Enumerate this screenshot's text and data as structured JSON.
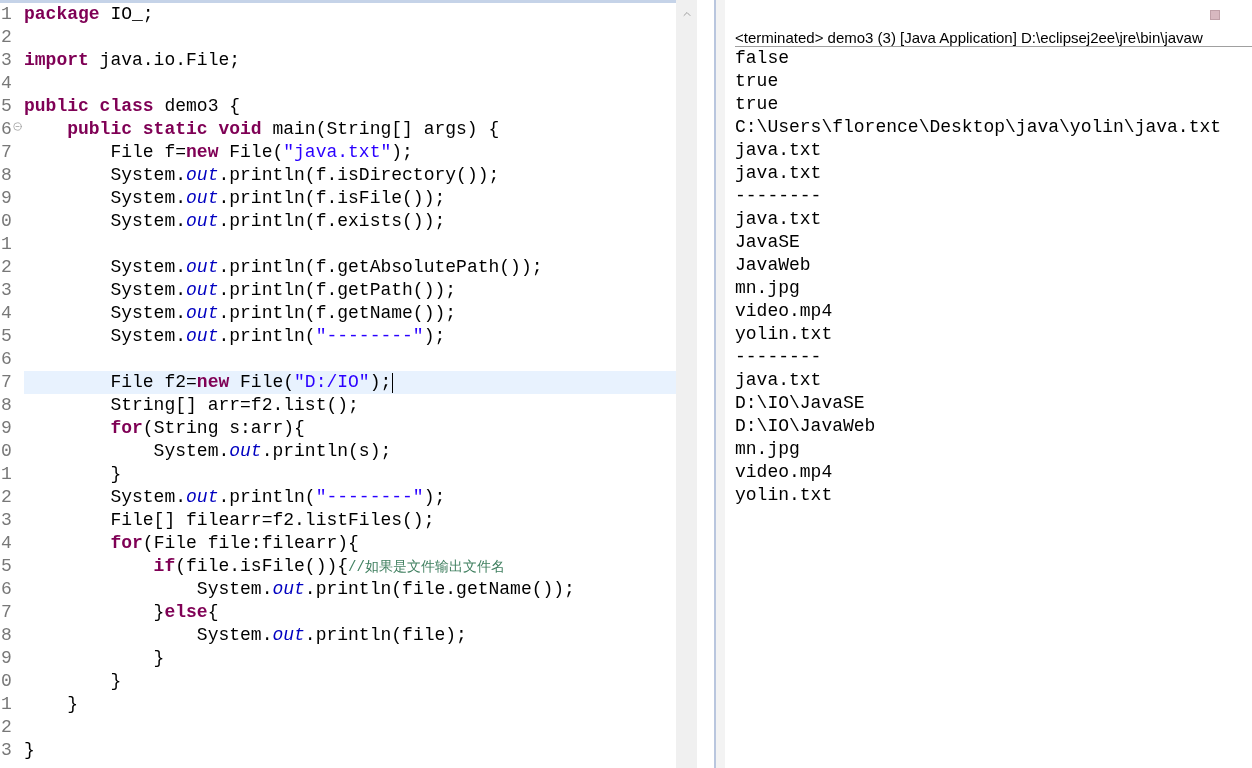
{
  "editor": {
    "lines": [
      {
        "number": "1",
        "tokens": [
          {
            "kind": "keyword",
            "text": "package"
          },
          {
            "kind": "plain",
            "text": " IO_;"
          }
        ]
      },
      {
        "number": "2"
      },
      {
        "number": "3",
        "tokens": [
          {
            "kind": "keyword",
            "text": "import"
          },
          {
            "kind": "plain",
            "text": " java.io.File;"
          }
        ]
      },
      {
        "number": "4"
      },
      {
        "number": "5",
        "tokens": [
          {
            "kind": "keyword",
            "text": "public class"
          },
          {
            "kind": "plain",
            "text": " demo3 {"
          }
        ]
      },
      {
        "number": "6",
        "folded": false,
        "tokens": [
          {
            "kind": "keyword",
            "text": "    public static void"
          },
          {
            "kind": "plain",
            "text": " main(String[] args) {"
          }
        ]
      },
      {
        "number": "7",
        "tokens": [
          {
            "kind": "plain",
            "text": "        File f="
          },
          {
            "kind": "keyword",
            "text": "new"
          },
          {
            "kind": "plain",
            "text": " File("
          },
          {
            "kind": "string",
            "text": "\"java.txt\""
          },
          {
            "kind": "plain",
            "text": ");"
          }
        ]
      },
      {
        "number": "8",
        "tokens": [
          {
            "kind": "plain",
            "text": "        System."
          },
          {
            "kind": "field",
            "text": "out"
          },
          {
            "kind": "plain",
            "text": ".println(f.isDirectory());"
          }
        ]
      },
      {
        "number": "9",
        "tokens": [
          {
            "kind": "plain",
            "text": "        System."
          },
          {
            "kind": "field",
            "text": "out"
          },
          {
            "kind": "plain",
            "text": ".println(f.isFile());"
          }
        ]
      },
      {
        "number": "0",
        "tokens": [
          {
            "kind": "plain",
            "text": "        System."
          },
          {
            "kind": "field",
            "text": "out"
          },
          {
            "kind": "plain",
            "text": ".println(f.exists());"
          }
        ]
      },
      {
        "number": "1"
      },
      {
        "number": "2",
        "tokens": [
          {
            "kind": "plain",
            "text": "        System."
          },
          {
            "kind": "field",
            "text": "out"
          },
          {
            "kind": "plain",
            "text": ".println(f.getAbsolutePath());"
          }
        ]
      },
      {
        "number": "3",
        "tokens": [
          {
            "kind": "plain",
            "text": "        System."
          },
          {
            "kind": "field",
            "text": "out"
          },
          {
            "kind": "plain",
            "text": ".println(f.getPath());"
          }
        ]
      },
      {
        "number": "4",
        "tokens": [
          {
            "kind": "plain",
            "text": "        System."
          },
          {
            "kind": "field",
            "text": "out"
          },
          {
            "kind": "plain",
            "text": ".println(f.getName());"
          }
        ]
      },
      {
        "number": "5",
        "tokens": [
          {
            "kind": "plain",
            "text": "        System."
          },
          {
            "kind": "field",
            "text": "out"
          },
          {
            "kind": "plain",
            "text": ".println("
          },
          {
            "kind": "string",
            "text": "\"--------\""
          },
          {
            "kind": "plain",
            "text": ");"
          }
        ]
      },
      {
        "number": "6"
      },
      {
        "number": "7",
        "current": true,
        "tokens": [
          {
            "kind": "plain",
            "text": "        File f2="
          },
          {
            "kind": "keyword",
            "text": "new"
          },
          {
            "kind": "plain",
            "text": " File("
          },
          {
            "kind": "string",
            "text": "\"D:/IO\""
          },
          {
            "kind": "plain",
            "text": ");"
          }
        ]
      },
      {
        "number": "8",
        "tokens": [
          {
            "kind": "plain",
            "text": "        String[] arr=f2.list();"
          }
        ]
      },
      {
        "number": "9",
        "tokens": [
          {
            "kind": "keyword",
            "text": "        for"
          },
          {
            "kind": "plain",
            "text": "(String s:arr){"
          }
        ]
      },
      {
        "number": "0",
        "tokens": [
          {
            "kind": "plain",
            "text": "            System."
          },
          {
            "kind": "field",
            "text": "out"
          },
          {
            "kind": "plain",
            "text": ".println(s);"
          }
        ]
      },
      {
        "number": "1",
        "tokens": [
          {
            "kind": "plain",
            "text": "        }"
          }
        ]
      },
      {
        "number": "2",
        "tokens": [
          {
            "kind": "plain",
            "text": "        System."
          },
          {
            "kind": "field",
            "text": "out"
          },
          {
            "kind": "plain",
            "text": ".println("
          },
          {
            "kind": "string",
            "text": "\"--------\""
          },
          {
            "kind": "plain",
            "text": ");"
          }
        ]
      },
      {
        "number": "3",
        "tokens": [
          {
            "kind": "plain",
            "text": "        File[] filearr=f2.listFiles();"
          }
        ]
      },
      {
        "number": "4",
        "tokens": [
          {
            "kind": "keyword",
            "text": "        for"
          },
          {
            "kind": "plain",
            "text": "(File file:filearr){"
          }
        ]
      },
      {
        "number": "5",
        "tokens": [
          {
            "kind": "keyword",
            "text": "            if"
          },
          {
            "kind": "plain",
            "text": "(file.isFile()){"
          },
          {
            "kind": "comment",
            "text": "//如果是文件输出文件名"
          }
        ]
      },
      {
        "number": "6",
        "tokens": [
          {
            "kind": "plain",
            "text": "                System."
          },
          {
            "kind": "field",
            "text": "out"
          },
          {
            "kind": "plain",
            "text": ".println(file.getName());"
          }
        ]
      },
      {
        "number": "7",
        "tokens": [
          {
            "kind": "plain",
            "text": "            }"
          },
          {
            "kind": "keyword",
            "text": "else"
          },
          {
            "kind": "plain",
            "text": "{"
          }
        ]
      },
      {
        "number": "8",
        "tokens": [
          {
            "kind": "plain",
            "text": "                System."
          },
          {
            "kind": "field",
            "text": "out"
          },
          {
            "kind": "plain",
            "text": ".println(file);"
          }
        ]
      },
      {
        "number": "9",
        "tokens": [
          {
            "kind": "plain",
            "text": "            }"
          }
        ]
      },
      {
        "number": "0",
        "tokens": [
          {
            "kind": "plain",
            "text": "        }"
          }
        ]
      },
      {
        "number": "1",
        "tokens": [
          {
            "kind": "plain",
            "text": "    }"
          }
        ]
      },
      {
        "number": "2"
      },
      {
        "number": "3",
        "tokens": [
          {
            "kind": "plain",
            "text": "}"
          }
        ]
      }
    ]
  },
  "console": {
    "header": "<terminated> demo3 (3) [Java Application] D:\\eclipsej2ee\\jre\\bin\\javaw",
    "output": [
      "false",
      "true",
      "true",
      "C:\\Users\\florence\\Desktop\\java\\yolin\\java.txt",
      "java.txt",
      "java.txt",
      "--------",
      "java.txt",
      "JavaSE",
      "JavaWeb",
      "mn.jpg",
      "video.mp4",
      "yolin.txt",
      "--------",
      "java.txt",
      "D:\\IO\\JavaSE",
      "D:\\IO\\JavaWeb",
      "mn.jpg",
      "video.mp4",
      "yolin.txt"
    ]
  }
}
